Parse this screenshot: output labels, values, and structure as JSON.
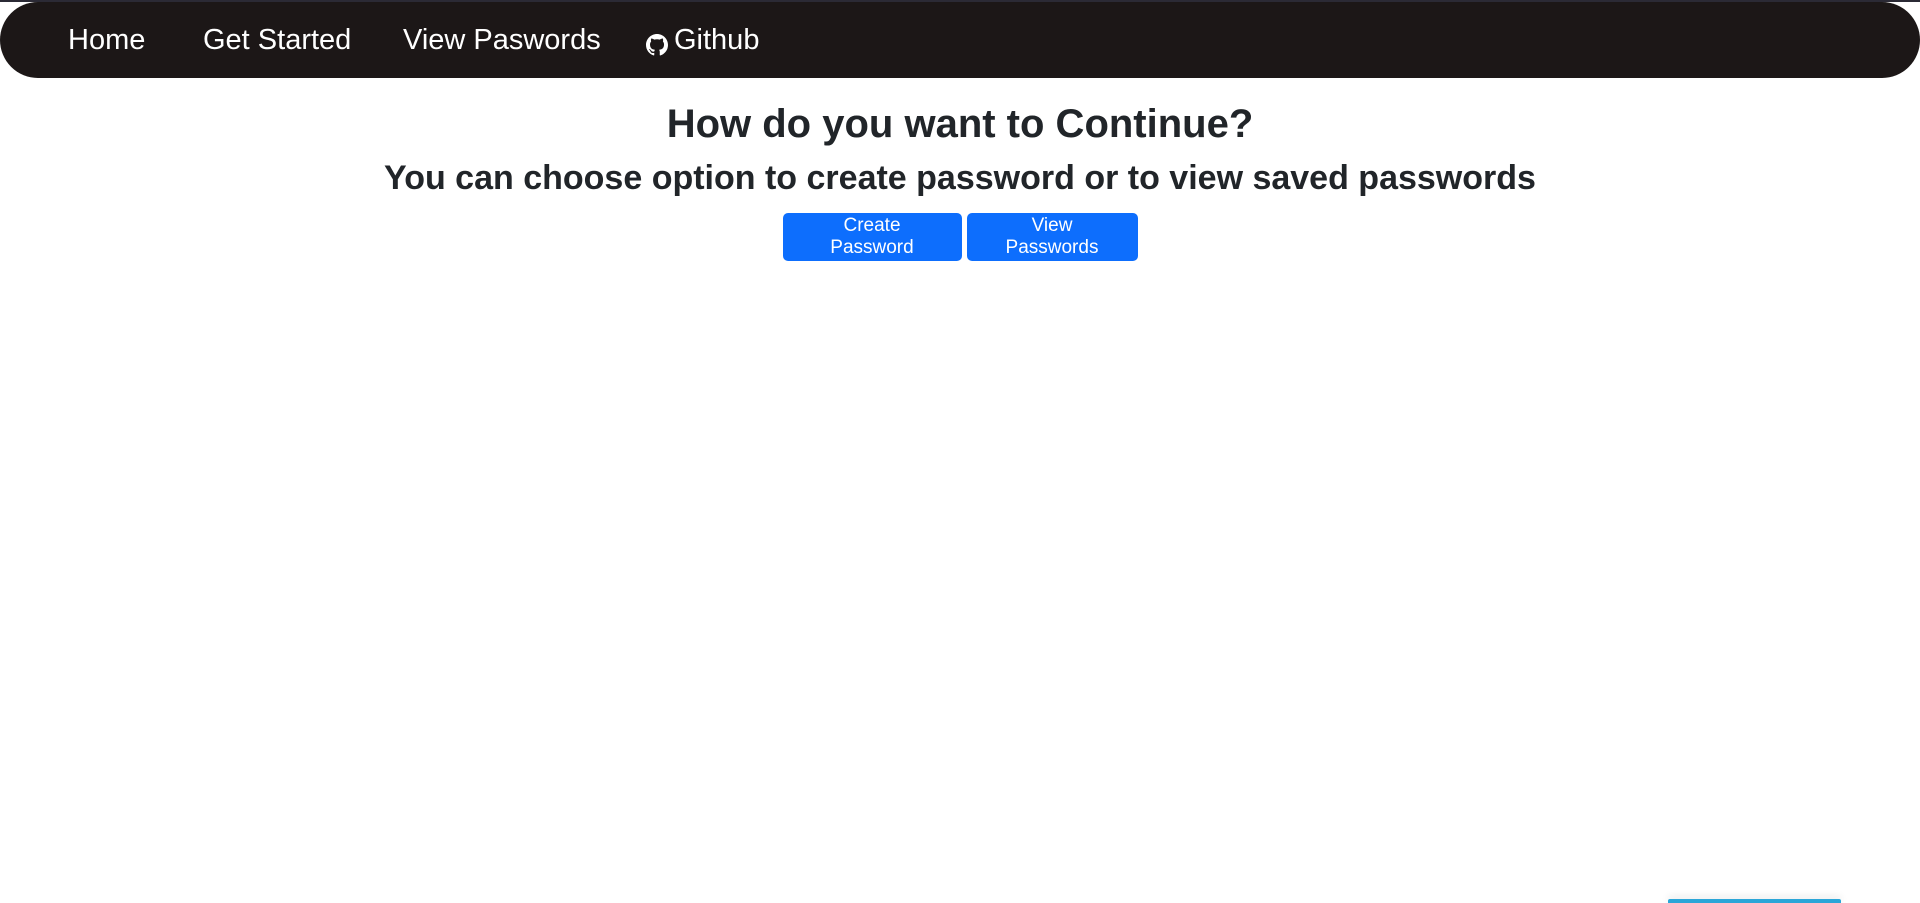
{
  "nav": {
    "items": [
      {
        "label": "Home"
      },
      {
        "label": "Get Started"
      },
      {
        "label": "View Paswords"
      },
      {
        "label": "Github"
      }
    ]
  },
  "main": {
    "title": "How do you want to Continue?",
    "subtitle": "You can choose option to create password or to view saved passwords",
    "buttons": [
      {
        "label": "Create Password"
      },
      {
        "label": "View Passwords"
      }
    ]
  },
  "colors": {
    "nav_background": "#1c1717",
    "primary_button": "#0d6efd",
    "page_background": "#ffffff",
    "text": "#212529"
  },
  "icons": {
    "github": "github-icon"
  }
}
